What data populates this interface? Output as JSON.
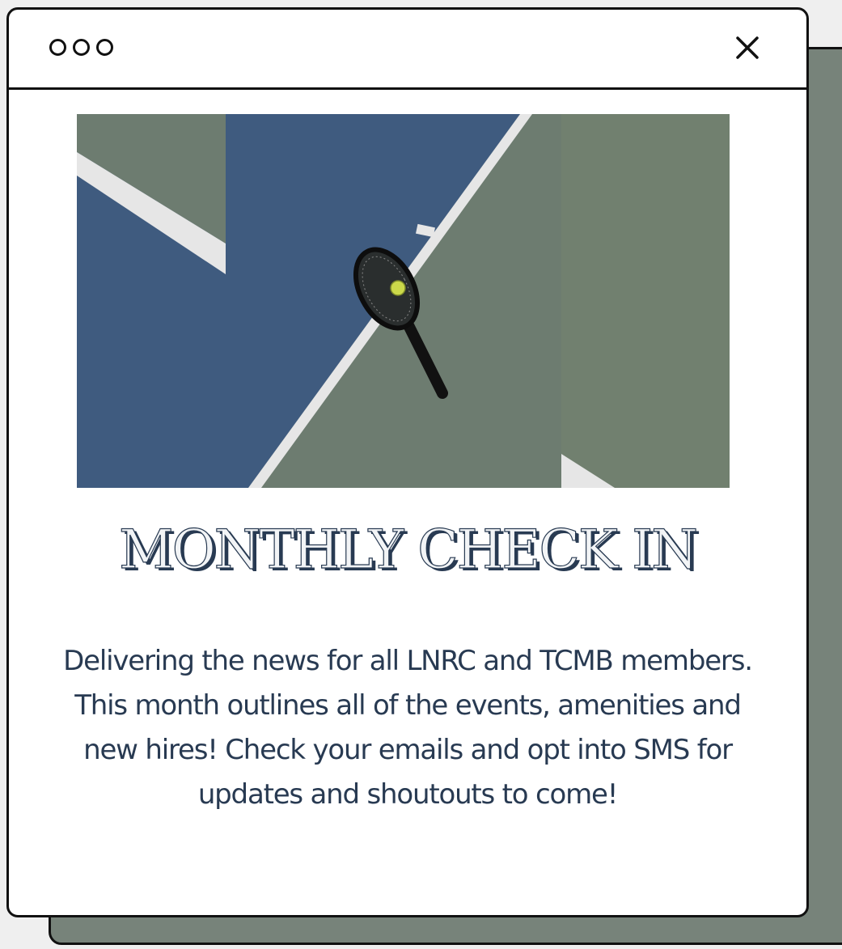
{
  "window": {
    "control_dots": [
      "dot-1",
      "dot-2",
      "dot-3"
    ],
    "close_icon": "close-icon"
  },
  "hero": {
    "icon": "tennis-racket-and-ball-image"
  },
  "content": {
    "headline": "MONTHLY CHECK IN",
    "body": "Delivering the news for all LNRC and TCMB members. This month outlines all of the events, amenities and new hires! Check your emails and opt into SMS for updates and shoutouts to come!"
  },
  "colors": {
    "shadow_card": "#77837a",
    "court_blue": "#3e5a7e",
    "court_green": "#6d7c70",
    "text_navy": "#283a52"
  }
}
